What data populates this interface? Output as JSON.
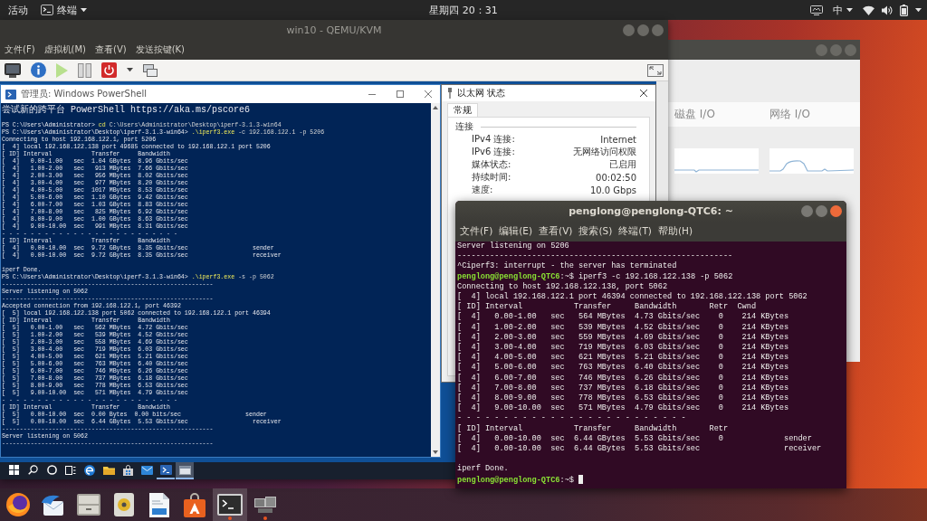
{
  "top_bar": {
    "activities": "活动",
    "app_menu": "终端",
    "clock": "星期四 20：31",
    "input_method": "中"
  },
  "qemu_window": {
    "title": "win10 - QEMU/KVM",
    "menu": [
      "文件(F)",
      "虚拟机(M)",
      "查看(V)",
      "发送按键(K)"
    ]
  },
  "powershell": {
    "title": "管理员: Windows PowerShell",
    "blocks": [
      {
        "lines": [
          {
            "kind": "banner",
            "text": "尝试新的跨平台 PowerShell https://aka.ms/pscore6"
          }
        ]
      },
      {
        "lines": [
          {
            "kind": "command",
            "prompt": "PS C:\\Users\\Administrator>",
            "command": "cd",
            "args": "C:\\Users\\Administrator\\Desktop\\iperf-3.1.3-win64"
          },
          {
            "kind": "command",
            "prompt": "PS C:\\Users\\Administrator\\Desktop\\iperf-3.1.3-win64>",
            "command": ".\\iperf3.exe",
            "args": "-c 192.168.122.1 -p 5206"
          },
          {
            "kind": "output",
            "text": "Connecting to host 192.168.122.1, port 5206"
          },
          {
            "kind": "output",
            "text": "[  4] local 192.168.122.138 port 49685 connected to 192.168.122.1 port 5206"
          },
          {
            "kind": "output",
            "text": "[ ID] Interval           Transfer     Bandwidth"
          },
          {
            "kind": "output",
            "text": "[  4]   0.00-1.00   sec  1.04 GBytes  8.96 Gbits/sec"
          },
          {
            "kind": "output",
            "text": "[  4]   1.00-2.00   sec   913 MBytes  7.66 Gbits/sec"
          },
          {
            "kind": "output",
            "text": "[  4]   2.00-3.00   sec   956 MBytes  8.02 Gbits/sec"
          },
          {
            "kind": "output",
            "text": "[  4]   3.00-4.00   sec   977 MBytes  8.20 Gbits/sec"
          },
          {
            "kind": "output",
            "text": "[  4]   4.00-5.00   sec  1017 MBytes  8.53 Gbits/sec"
          },
          {
            "kind": "output",
            "text": "[  4]   5.00-6.00   sec  1.10 GBytes  9.42 Gbits/sec"
          },
          {
            "kind": "output",
            "text": "[  4]   6.00-7.00   sec  1.03 GBytes  8.83 Gbits/sec"
          },
          {
            "kind": "output",
            "text": "[  4]   7.00-8.00   sec   825 MBytes  6.92 Gbits/sec"
          },
          {
            "kind": "output",
            "text": "[  4]   8.00-9.00   sec  1.00 GBytes  8.63 Gbits/sec"
          },
          {
            "kind": "output",
            "text": "[  4]   9.00-10.00  sec   991 MBytes  8.31 Gbits/sec"
          },
          {
            "kind": "output",
            "text": "- - - - - - - - - - - - - - - - - - - - - - - - -"
          },
          {
            "kind": "output",
            "text": "[ ID] Interval           Transfer     Bandwidth"
          },
          {
            "kind": "output",
            "text": "[  4]   0.00-10.00  sec  9.72 GBytes  8.35 Gbits/sec                  sender"
          },
          {
            "kind": "output",
            "text": "[  4]   0.00-10.00  sec  9.72 GBytes  8.35 Gbits/sec                  receiver"
          }
        ]
      },
      {
        "lines": [
          {
            "kind": "output",
            "text": "iperf Done."
          },
          {
            "kind": "command",
            "prompt": "PS C:\\Users\\Administrator\\Desktop\\iperf-3.1.3-win64>",
            "command": ".\\iperf3.exe",
            "args": "-s -p 5062"
          },
          {
            "kind": "output",
            "text": "-----------------------------------------------------------"
          },
          {
            "kind": "output",
            "text": "Server listening on 5062"
          },
          {
            "kind": "output",
            "text": "-----------------------------------------------------------"
          },
          {
            "kind": "output",
            "text": "Accepted connection from 192.168.122.1, port 46392"
          },
          {
            "kind": "output",
            "text": "[  5] local 192.168.122.138 port 5062 connected to 192.168.122.1 port 46394"
          },
          {
            "kind": "output",
            "text": "[ ID] Interval           Transfer     Bandwidth"
          },
          {
            "kind": "output",
            "text": "[  5]   0.00-1.00   sec   562 MBytes  4.72 Gbits/sec"
          },
          {
            "kind": "output",
            "text": "[  5]   1.00-2.00   sec   539 MBytes  4.52 Gbits/sec"
          },
          {
            "kind": "output",
            "text": "[  5]   2.00-3.00   sec   558 MBytes  4.69 Gbits/sec"
          },
          {
            "kind": "output",
            "text": "[  5]   3.00-4.00   sec   719 MBytes  6.03 Gbits/sec"
          },
          {
            "kind": "output",
            "text": "[  5]   4.00-5.00   sec   621 MBytes  5.21 Gbits/sec"
          },
          {
            "kind": "output",
            "text": "[  5]   5.00-6.00   sec   763 MBytes  6.40 Gbits/sec"
          },
          {
            "kind": "output",
            "text": "[  5]   6.00-7.00   sec   746 MBytes  6.26 Gbits/sec"
          },
          {
            "kind": "output",
            "text": "[  5]   7.00-8.00   sec   737 MBytes  6.18 Gbits/sec"
          },
          {
            "kind": "output",
            "text": "[  5]   8.00-9.00   sec   778 MBytes  6.53 Gbits/sec"
          },
          {
            "kind": "output",
            "text": "[  5]   9.00-10.00  sec   571 MBytes  4.79 Gbits/sec"
          },
          {
            "kind": "output",
            "text": "- - - - - - - - - - - - - - - - - - - - - - - - -"
          },
          {
            "kind": "output",
            "text": "[ ID] Interval           Transfer     Bandwidth"
          },
          {
            "kind": "output",
            "text": "[  5]   0.00-10.00  sec  0.00 Bytes  0.00 bits/sec                  sender"
          },
          {
            "kind": "output",
            "text": "[  5]   0.00-10.00  sec  6.44 GBytes  5.53 Gbits/sec                  receiver"
          },
          {
            "kind": "output",
            "text": "-----------------------------------------------------------"
          },
          {
            "kind": "output",
            "text": "Server listening on 5062"
          },
          {
            "kind": "output",
            "text": "-----------------------------------------------------------"
          }
        ]
      }
    ]
  },
  "network_dialog": {
    "title": "以太网 状态",
    "tab": "常规",
    "group": "连接",
    "rows": [
      {
        "label": "IPv4 连接:",
        "value": "Internet"
      },
      {
        "label": "IPv6 连接:",
        "value": "无网络访问权限"
      },
      {
        "label": "媒体状态:",
        "value": "已启用"
      },
      {
        "label": "持续时间:",
        "value": "00:02:50"
      },
      {
        "label": "速度:",
        "value": "10.0 Gbps"
      }
    ]
  },
  "windows_taskbar": {
    "items": [
      {
        "kind": "start",
        "open": false,
        "focused": false
      },
      {
        "kind": "search",
        "open": false,
        "focused": false
      },
      {
        "kind": "cortana",
        "open": false,
        "focused": false
      },
      {
        "kind": "task_view",
        "open": false,
        "focused": false
      },
      {
        "kind": "edge",
        "open": false,
        "focused": false
      },
      {
        "kind": "explorer",
        "open": false,
        "focused": false
      },
      {
        "kind": "store",
        "open": false,
        "focused": false
      },
      {
        "kind": "mail",
        "open": false,
        "focused": false
      },
      {
        "kind": "powershell",
        "open": true,
        "focused": false
      },
      {
        "kind": "window",
        "open": true,
        "focused": true
      }
    ]
  },
  "system_monitor": {
    "panels": [
      {
        "title": "磁盘 I/O"
      },
      {
        "title": "网络 I/O"
      }
    ]
  },
  "terminal": {
    "title": "penglong@penglong-QTC6: ~",
    "menu": [
      "文件(F)",
      "编辑(E)",
      "查看(V)",
      "搜索(S)",
      "终端(T)",
      "帮助(H)"
    ],
    "blocks": [
      {
        "lines": [
          {
            "kind": "output",
            "text": "Server listening on 5206"
          },
          {
            "kind": "output",
            "text": "-----------------------------------------------------------"
          },
          {
            "kind": "output",
            "text": "^Ciperf3: interrupt - the server has terminated"
          },
          {
            "kind": "prompt",
            "user_host": "penglong@penglong-QTC6",
            "path": ":~$",
            "command": "iperf3 -c 192.168.122.138 -p 5062"
          },
          {
            "kind": "output",
            "text": "Connecting to host 192.168.122.138, port 5062"
          },
          {
            "kind": "output",
            "text": "[  4] local 192.168.122.1 port 46394 connected to 192.168.122.138 port 5062"
          },
          {
            "kind": "output",
            "text": "[ ID] Interval           Transfer     Bandwidth       Retr  Cwnd"
          },
          {
            "kind": "output",
            "text": "[  4]   0.00-1.00   sec   564 MBytes  4.73 Gbits/sec    0    214 KBytes"
          },
          {
            "kind": "output",
            "text": "[  4]   1.00-2.00   sec   539 MBytes  4.52 Gbits/sec    0    214 KBytes"
          },
          {
            "kind": "output",
            "text": "[  4]   2.00-3.00   sec   559 MBytes  4.69 Gbits/sec    0    214 KBytes"
          },
          {
            "kind": "output",
            "text": "[  4]   3.00-4.00   sec   719 MBytes  6.03 Gbits/sec    0    214 KBytes"
          },
          {
            "kind": "output",
            "text": "[  4]   4.00-5.00   sec   621 MBytes  5.21 Gbits/sec    0    214 KBytes"
          },
          {
            "kind": "output",
            "text": "[  4]   5.00-6.00   sec   763 MBytes  6.40 Gbits/sec    0    214 KBytes"
          },
          {
            "kind": "output",
            "text": "[  4]   6.00-7.00   sec   746 MBytes  6.26 Gbits/sec    0    214 KBytes"
          },
          {
            "kind": "output",
            "text": "[  4]   7.00-8.00   sec   737 MBytes  6.18 Gbits/sec    0    214 KBytes"
          },
          {
            "kind": "output",
            "text": "[  4]   8.00-9.00   sec   778 MBytes  6.53 Gbits/sec    0    214 KBytes"
          },
          {
            "kind": "output",
            "text": "[  4]   9.00-10.00  sec   571 MBytes  4.79 Gbits/sec    0    214 KBytes"
          },
          {
            "kind": "output",
            "text": "- - - - - - - - - - - - - - - - - - - - - - - - -"
          },
          {
            "kind": "output",
            "text": "[ ID] Interval           Transfer     Bandwidth       Retr"
          },
          {
            "kind": "output",
            "text": "[  4]   0.00-10.00  sec  6.44 GBytes  5.53 Gbits/sec    0             sender"
          },
          {
            "kind": "output",
            "text": "[  4]   0.00-10.00  sec  6.44 GBytes  5.53 Gbits/sec                  receiver"
          }
        ]
      },
      {
        "lines": [
          {
            "kind": "output",
            "text": "iperf Done."
          },
          {
            "kind": "prompt",
            "user_host": "penglong@penglong-QTC6",
            "path": ":~$",
            "cursor": true
          }
        ]
      }
    ]
  },
  "dock": {
    "items": [
      {
        "kind": "browser",
        "focused": false,
        "running": false
      },
      {
        "kind": "mail",
        "focused": false,
        "running": false
      },
      {
        "kind": "files",
        "focused": false,
        "running": false
      },
      {
        "kind": "media",
        "focused": false,
        "running": false
      },
      {
        "kind": "writer",
        "focused": false,
        "running": false
      },
      {
        "kind": "software",
        "focused": false,
        "running": false
      },
      {
        "kind": "terminal",
        "focused": true,
        "running": true
      },
      {
        "kind": "vm",
        "focused": false,
        "running": true
      }
    ]
  }
}
